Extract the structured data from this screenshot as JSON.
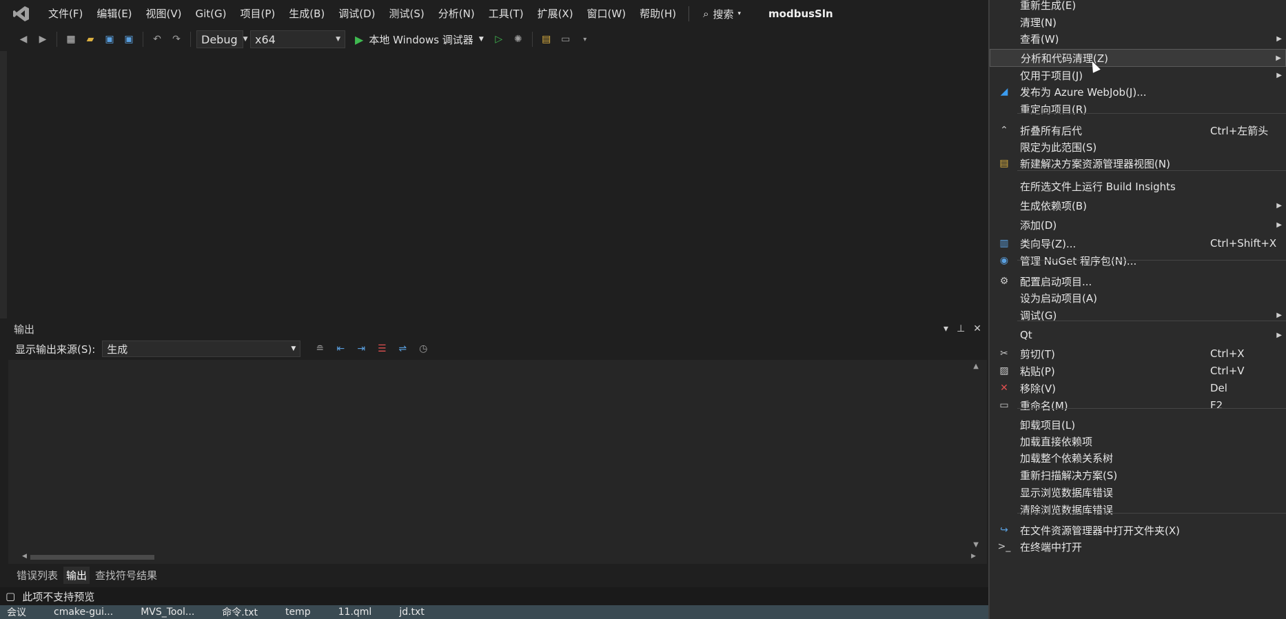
{
  "menubar": {
    "items": [
      "文件(F)",
      "编辑(E)",
      "视图(V)",
      "Git(G)",
      "项目(P)",
      "生成(B)",
      "调试(D)",
      "测试(S)",
      "分析(N)",
      "工具(T)",
      "扩展(X)",
      "窗口(W)",
      "帮助(H)"
    ],
    "search": "搜索",
    "solution": "modbusSln"
  },
  "toolbar": {
    "config": "Debug",
    "platform": "x64",
    "run_label": "本地 Windows 调试器"
  },
  "output": {
    "title": "输出",
    "source_label": "显示输出来源(S):",
    "source_value": "生成"
  },
  "bottom_tabs": [
    "错误列表",
    "输出",
    "查找符号结果"
  ],
  "status": {
    "text": "此项不支持预览"
  },
  "taskbar": [
    "会议",
    "cmake-gui...",
    "MVS_Tool...",
    "命令.txt",
    "temp",
    "11.qml",
    "jd.txt"
  ],
  "context_menu": {
    "items": [
      {
        "label": "重新生成(E)",
        "icon": "",
        "shortcut": "",
        "submenu": false
      },
      {
        "label": "清理(N)",
        "icon": "",
        "shortcut": "",
        "submenu": false
      },
      {
        "label": "查看(W)",
        "icon": "",
        "shortcut": "",
        "submenu": true
      },
      {
        "label": "分析和代码清理(Z)",
        "icon": "",
        "shortcut": "",
        "submenu": true,
        "highlighted": true
      },
      {
        "label": "仅用于项目(J)",
        "icon": "",
        "shortcut": "",
        "submenu": true
      },
      {
        "label": "发布为 Azure WebJob(J)...",
        "icon": "azure-icon",
        "shortcut": "",
        "submenu": false
      },
      {
        "label": "重定向项目(R)",
        "icon": "",
        "shortcut": "",
        "submenu": false
      },
      {
        "label": "折叠所有后代",
        "icon": "collapse-icon",
        "shortcut": "Ctrl+左箭头",
        "submenu": false
      },
      {
        "label": "限定为此范围(S)",
        "icon": "",
        "shortcut": "",
        "submenu": false
      },
      {
        "label": "新建解决方案资源管理器视图(N)",
        "icon": "new-view-icon",
        "shortcut": "",
        "submenu": false
      },
      {
        "label": "在所选文件上运行 Build Insights",
        "icon": "",
        "shortcut": "",
        "submenu": false
      },
      {
        "label": "生成依赖项(B)",
        "icon": "",
        "shortcut": "",
        "submenu": true
      },
      {
        "label": "添加(D)",
        "icon": "",
        "shortcut": "",
        "submenu": true
      },
      {
        "label": "类向导(Z)...",
        "icon": "class-wizard-icon",
        "shortcut": "Ctrl+Shift+X",
        "submenu": false
      },
      {
        "label": "管理 NuGet 程序包(N)...",
        "icon": "nuget-icon",
        "shortcut": "",
        "submenu": false
      },
      {
        "label": "配置启动项目...",
        "icon": "gear-icon",
        "shortcut": "",
        "submenu": false
      },
      {
        "label": "设为启动项目(A)",
        "icon": "",
        "shortcut": "",
        "submenu": false
      },
      {
        "label": "调试(G)",
        "icon": "",
        "shortcut": "",
        "submenu": true
      },
      {
        "label": "Qt",
        "icon": "",
        "shortcut": "",
        "submenu": true
      },
      {
        "label": "剪切(T)",
        "icon": "scissors-icon",
        "shortcut": "Ctrl+X",
        "submenu": false
      },
      {
        "label": "粘贴(P)",
        "icon": "paste-icon",
        "shortcut": "Ctrl+V",
        "submenu": false
      },
      {
        "label": "移除(V)",
        "icon": "remove-icon",
        "shortcut": "Del",
        "submenu": false
      },
      {
        "label": "重命名(M)",
        "icon": "rename-icon",
        "shortcut": "F2",
        "submenu": false
      },
      {
        "label": "卸载项目(L)",
        "icon": "",
        "shortcut": "",
        "submenu": false
      },
      {
        "label": "加载直接依赖项",
        "icon": "",
        "shortcut": "",
        "submenu": false
      },
      {
        "label": "加载整个依赖关系树",
        "icon": "",
        "shortcut": "",
        "submenu": false
      },
      {
        "label": "重新扫描解决方案(S)",
        "icon": "",
        "shortcut": "",
        "submenu": false
      },
      {
        "label": "显示浏览数据库错误",
        "icon": "",
        "shortcut": "",
        "submenu": false
      },
      {
        "label": "清除浏览数据库错误",
        "icon": "",
        "shortcut": "",
        "submenu": false
      },
      {
        "label": "在文件资源管理器中打开文件夹(X)",
        "icon": "open-folder-icon",
        "shortcut": "",
        "submenu": false
      },
      {
        "label": "在终端中打开",
        "icon": "terminal-icon",
        "shortcut": "",
        "submenu": false
      }
    ]
  }
}
